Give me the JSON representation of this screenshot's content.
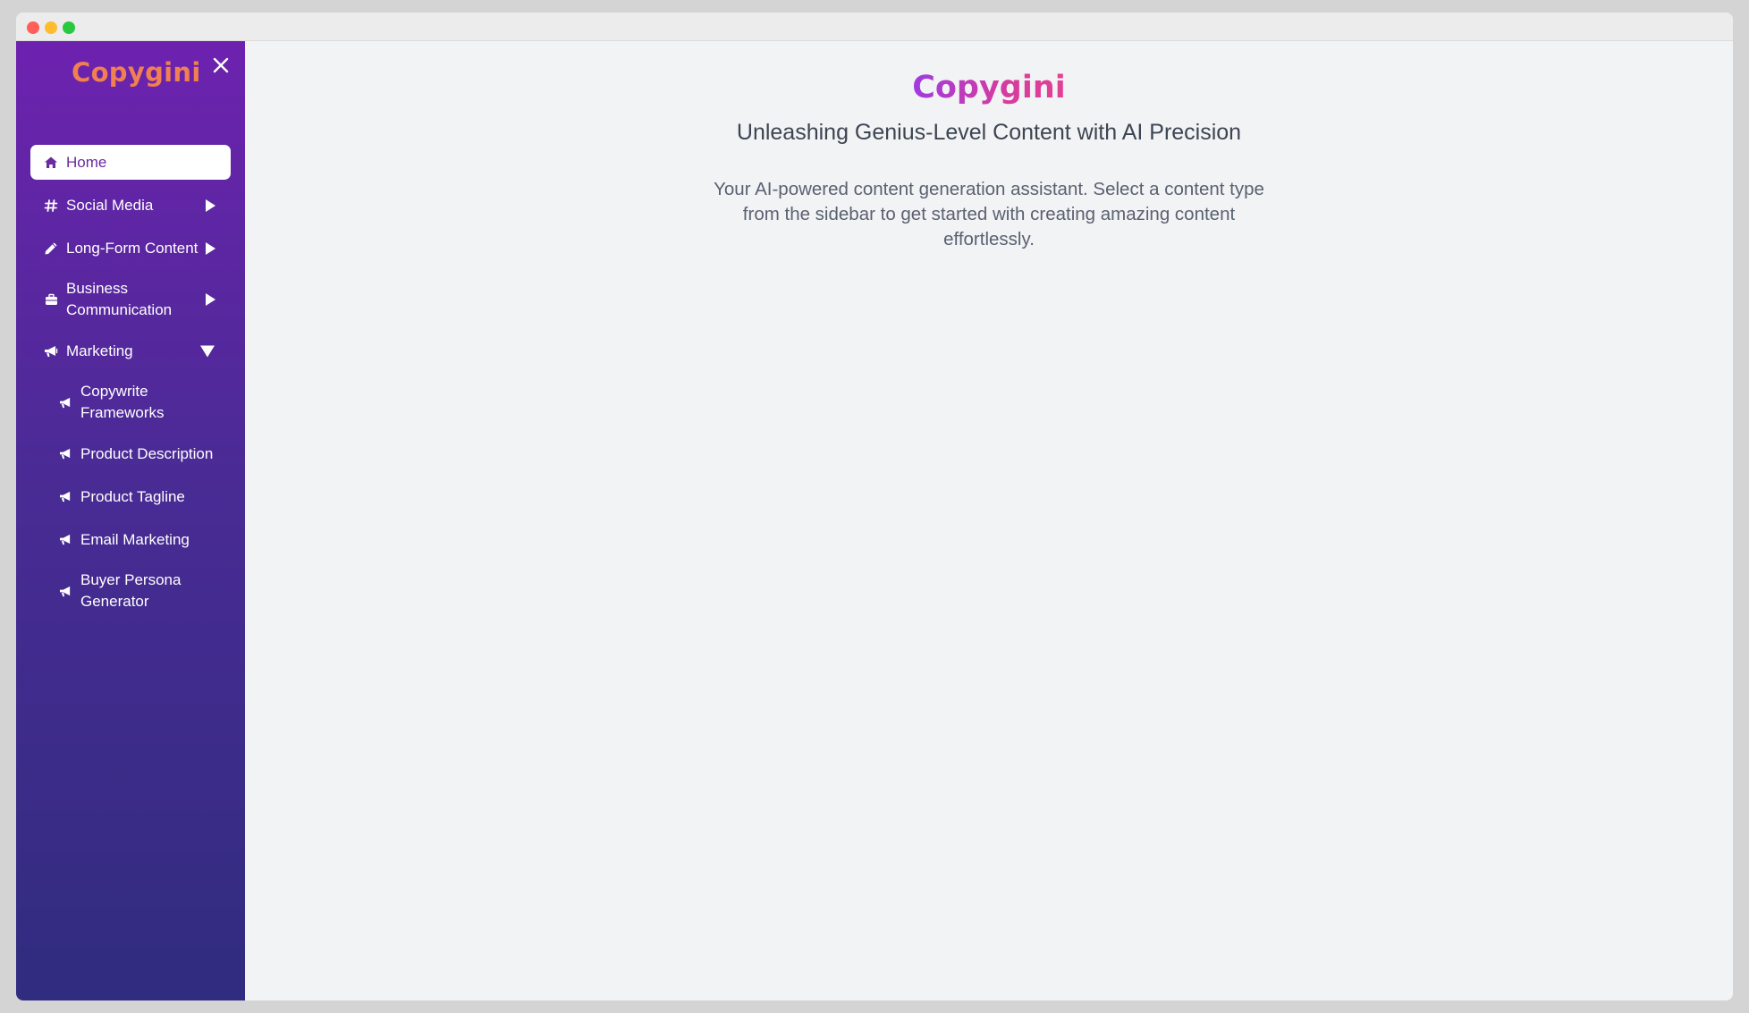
{
  "window": {
    "controls": [
      {
        "name": "close",
        "color": "#ff5f57"
      },
      {
        "name": "minimize",
        "color": "#febc2e"
      },
      {
        "name": "maximize",
        "color": "#28c840"
      }
    ]
  },
  "sidebar": {
    "brand": "Copygini",
    "close_icon": "close-icon",
    "items": [
      {
        "label": "Home",
        "icon": "home-icon",
        "active": true
      },
      {
        "label": "Social Media",
        "icon": "hash-icon",
        "expander": "collapsed"
      },
      {
        "label": "Long-Form Content",
        "icon": "pencil-icon",
        "expander": "collapsed"
      },
      {
        "label": "Business Communication",
        "icon": "briefcase-icon",
        "expander": "collapsed"
      },
      {
        "label": "Marketing",
        "icon": "megaphone-icon",
        "expander": "expanded"
      }
    ],
    "marketing_subitems": [
      {
        "label": "Copywrite Frameworks",
        "icon": "megaphone-icon"
      },
      {
        "label": "Product Description",
        "icon": "megaphone-icon"
      },
      {
        "label": "Product Tagline",
        "icon": "megaphone-icon"
      },
      {
        "label": "Email Marketing",
        "icon": "megaphone-icon"
      },
      {
        "label": "Buyer Persona Generator",
        "icon": "megaphone-icon"
      }
    ]
  },
  "main": {
    "title": "Copygini",
    "subtitle": "Unleashing Genius-Level Content with AI Precision",
    "description": "Your AI-powered content generation assistant. Select a content type from the sidebar to get started with creating amazing content effortlessly."
  },
  "colors": {
    "sidebar_top": "#6d22af",
    "sidebar_bottom": "#302c7f",
    "brand_orange": "#f07f52",
    "title_purple": "#9f3be0",
    "title_pink": "#e24294",
    "active_text": "#6a2aa0"
  }
}
